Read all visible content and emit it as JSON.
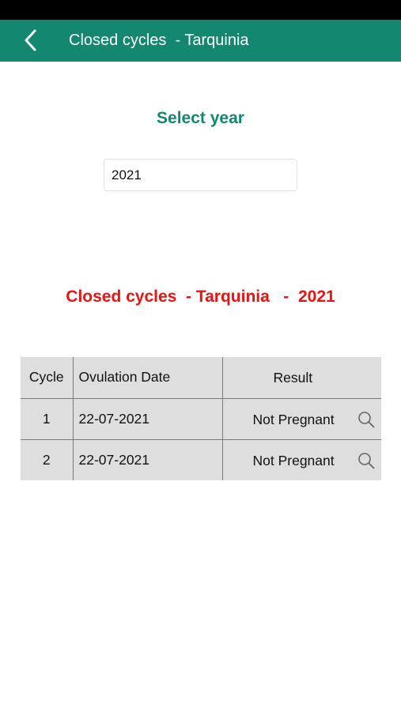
{
  "header": {
    "title": "Closed cycles  - Tarquinia"
  },
  "year_selector": {
    "label": "Select year",
    "value": "2021"
  },
  "section": {
    "title": "Closed cycles  - Tarquinia   -  2021"
  },
  "table": {
    "columns": [
      "Cycle",
      "Ovulation Date",
      "Result"
    ],
    "rows": [
      {
        "cycle": "1",
        "date": "22-07-2021",
        "result": "Not Pregnant"
      },
      {
        "cycle": "2",
        "date": "22-07-2021",
        "result": "Not Pregnant"
      }
    ]
  },
  "colors": {
    "brand_green": "#138770",
    "title_red": "#ee1111",
    "table_bg": "#dedede"
  },
  "icons": {
    "back": "chevron-left-icon",
    "detail": "magnifier-icon"
  }
}
